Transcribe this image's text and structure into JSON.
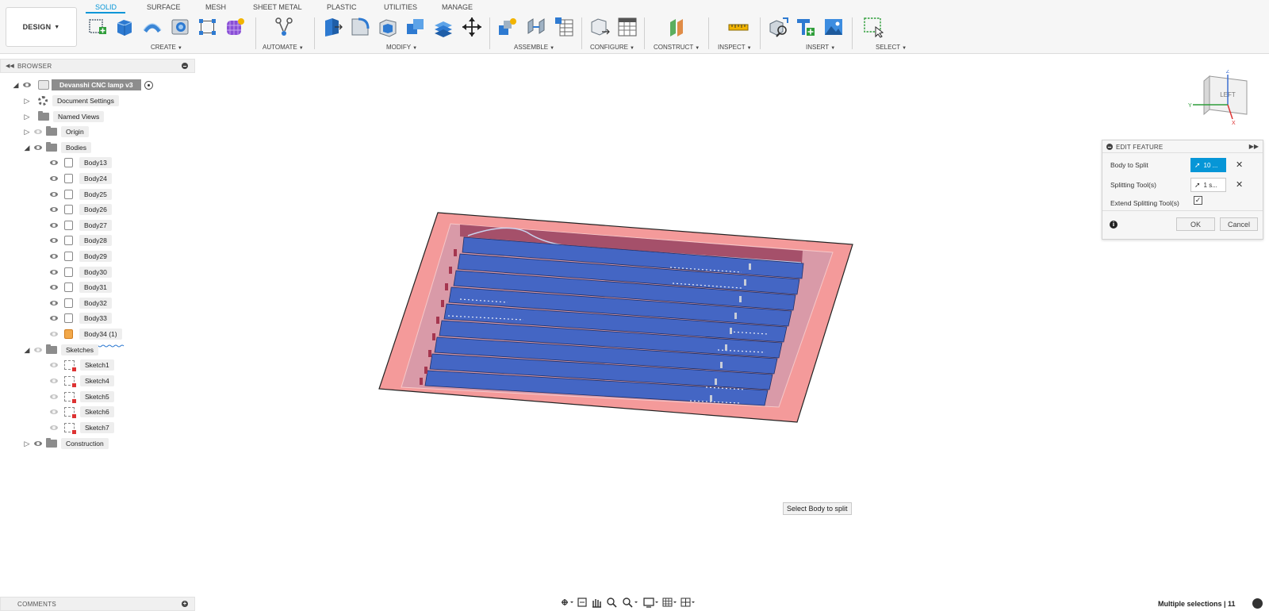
{
  "workspace": {
    "label": "DESIGN"
  },
  "tabs": [
    {
      "label": "SOLID"
    },
    {
      "label": "SURFACE"
    },
    {
      "label": "MESH"
    },
    {
      "label": "SHEET METAL"
    },
    {
      "label": "PLASTIC"
    },
    {
      "label": "UTILITIES"
    },
    {
      "label": "MANAGE"
    }
  ],
  "active_tab": "SOLID",
  "groups": [
    {
      "label": "CREATE"
    },
    {
      "label": "AUTOMATE"
    },
    {
      "label": "MODIFY"
    },
    {
      "label": "ASSEMBLE"
    },
    {
      "label": "CONFIGURE"
    },
    {
      "label": "CONSTRUCT"
    },
    {
      "label": "INSPECT"
    },
    {
      "label": "INSERT"
    },
    {
      "label": "SELECT"
    }
  ],
  "tool_icons": [
    "new-sketch-icon",
    "extrude-icon",
    "sweep-icon",
    "hole-icon",
    "rectangle-pattern-icon",
    "form-icon",
    "automate-icon",
    "press-pull-icon",
    "fillet-icon",
    "shell-icon",
    "combine-icon",
    "replace-face-icon",
    "move-icon",
    "new-component-icon",
    "joint-icon",
    "bom-icon",
    "configure-icon",
    "table-icon",
    "offset-plane-icon",
    "measure-icon",
    "insert-derive-icon",
    "insert-mcmaster-icon",
    "insert-image-icon",
    "window-select-icon"
  ],
  "browser": {
    "title": "BROWSER",
    "root": {
      "label": "Devanshi CNC lamp v3"
    },
    "items": [
      {
        "label": "Document Settings"
      },
      {
        "label": "Named Views"
      },
      {
        "label": "Origin"
      },
      {
        "label": "Bodies"
      }
    ],
    "bodies": [
      {
        "label": "Body13"
      },
      {
        "label": "Body24"
      },
      {
        "label": "Body25"
      },
      {
        "label": "Body26"
      },
      {
        "label": "Body27"
      },
      {
        "label": "Body28"
      },
      {
        "label": "Body29"
      },
      {
        "label": "Body30"
      },
      {
        "label": "Body31"
      },
      {
        "label": "Body32"
      },
      {
        "label": "Body33"
      },
      {
        "label": "Body34 (1)"
      }
    ],
    "sketches_folder": {
      "label": "Sketches"
    },
    "sketches": [
      {
        "label": "Sketch1"
      },
      {
        "label": "Sketch4"
      },
      {
        "label": "Sketch5"
      },
      {
        "label": "Sketch6"
      },
      {
        "label": "Sketch7"
      }
    ],
    "construction": {
      "label": "Construction"
    }
  },
  "comments": {
    "title": "COMMENTS"
  },
  "viewcube": {
    "face_label": "LEFT",
    "axis_z": "Z",
    "axis_y": "Y",
    "axis_x": "X"
  },
  "dialog": {
    "title": "EDIT FEATURE",
    "body_to_split": {
      "label": "Body to Split",
      "value": "10 ..."
    },
    "splitting_tools": {
      "label": "Splitting Tool(s)",
      "value": "1 s..."
    },
    "extend": {
      "label": "Extend Splitting Tool(s)",
      "checked": true
    },
    "ok_label": "OK",
    "cancel_label": "Cancel"
  },
  "tooltip": {
    "text": "Select Body to split"
  },
  "nav_icons": [
    "orbit-icon",
    "look-at-icon",
    "pan-icon",
    "zoom-icon",
    "zoom-window-icon",
    "display-settings-icon",
    "grid-settings-icon",
    "viewports-icon"
  ],
  "status": {
    "text": "Multiple selections | 11"
  },
  "colors": {
    "accent": "#0696d7",
    "selected_body": "#4466c4",
    "split_tool": "#f08a8a",
    "toolbar_bg": "#f6f6f6"
  }
}
